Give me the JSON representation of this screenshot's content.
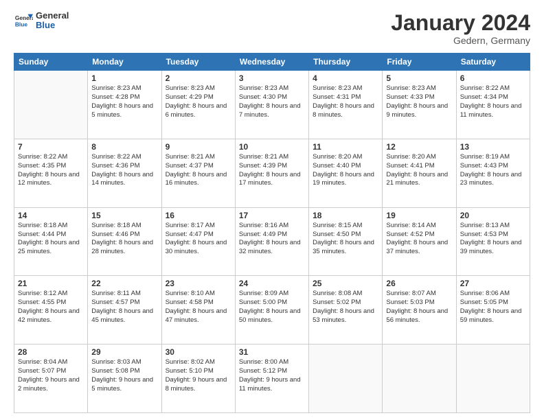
{
  "logo": {
    "text_general": "General",
    "text_blue": "Blue"
  },
  "header": {
    "month_title": "January 2024",
    "location": "Gedern, Germany"
  },
  "weekdays": [
    "Sunday",
    "Monday",
    "Tuesday",
    "Wednesday",
    "Thursday",
    "Friday",
    "Saturday"
  ],
  "weeks": [
    [
      {
        "day": "",
        "sunrise": "",
        "sunset": "",
        "daylight": ""
      },
      {
        "day": "1",
        "sunrise": "Sunrise: 8:23 AM",
        "sunset": "Sunset: 4:28 PM",
        "daylight": "Daylight: 8 hours and 5 minutes."
      },
      {
        "day": "2",
        "sunrise": "Sunrise: 8:23 AM",
        "sunset": "Sunset: 4:29 PM",
        "daylight": "Daylight: 8 hours and 6 minutes."
      },
      {
        "day": "3",
        "sunrise": "Sunrise: 8:23 AM",
        "sunset": "Sunset: 4:30 PM",
        "daylight": "Daylight: 8 hours and 7 minutes."
      },
      {
        "day": "4",
        "sunrise": "Sunrise: 8:23 AM",
        "sunset": "Sunset: 4:31 PM",
        "daylight": "Daylight: 8 hours and 8 minutes."
      },
      {
        "day": "5",
        "sunrise": "Sunrise: 8:23 AM",
        "sunset": "Sunset: 4:33 PM",
        "daylight": "Daylight: 8 hours and 9 minutes."
      },
      {
        "day": "6",
        "sunrise": "Sunrise: 8:22 AM",
        "sunset": "Sunset: 4:34 PM",
        "daylight": "Daylight: 8 hours and 11 minutes."
      }
    ],
    [
      {
        "day": "7",
        "sunrise": "Sunrise: 8:22 AM",
        "sunset": "Sunset: 4:35 PM",
        "daylight": "Daylight: 8 hours and 12 minutes."
      },
      {
        "day": "8",
        "sunrise": "Sunrise: 8:22 AM",
        "sunset": "Sunset: 4:36 PM",
        "daylight": "Daylight: 8 hours and 14 minutes."
      },
      {
        "day": "9",
        "sunrise": "Sunrise: 8:21 AM",
        "sunset": "Sunset: 4:37 PM",
        "daylight": "Daylight: 8 hours and 16 minutes."
      },
      {
        "day": "10",
        "sunrise": "Sunrise: 8:21 AM",
        "sunset": "Sunset: 4:39 PM",
        "daylight": "Daylight: 8 hours and 17 minutes."
      },
      {
        "day": "11",
        "sunrise": "Sunrise: 8:20 AM",
        "sunset": "Sunset: 4:40 PM",
        "daylight": "Daylight: 8 hours and 19 minutes."
      },
      {
        "day": "12",
        "sunrise": "Sunrise: 8:20 AM",
        "sunset": "Sunset: 4:41 PM",
        "daylight": "Daylight: 8 hours and 21 minutes."
      },
      {
        "day": "13",
        "sunrise": "Sunrise: 8:19 AM",
        "sunset": "Sunset: 4:43 PM",
        "daylight": "Daylight: 8 hours and 23 minutes."
      }
    ],
    [
      {
        "day": "14",
        "sunrise": "Sunrise: 8:18 AM",
        "sunset": "Sunset: 4:44 PM",
        "daylight": "Daylight: 8 hours and 25 minutes."
      },
      {
        "day": "15",
        "sunrise": "Sunrise: 8:18 AM",
        "sunset": "Sunset: 4:46 PM",
        "daylight": "Daylight: 8 hours and 28 minutes."
      },
      {
        "day": "16",
        "sunrise": "Sunrise: 8:17 AM",
        "sunset": "Sunset: 4:47 PM",
        "daylight": "Daylight: 8 hours and 30 minutes."
      },
      {
        "day": "17",
        "sunrise": "Sunrise: 8:16 AM",
        "sunset": "Sunset: 4:49 PM",
        "daylight": "Daylight: 8 hours and 32 minutes."
      },
      {
        "day": "18",
        "sunrise": "Sunrise: 8:15 AM",
        "sunset": "Sunset: 4:50 PM",
        "daylight": "Daylight: 8 hours and 35 minutes."
      },
      {
        "day": "19",
        "sunrise": "Sunrise: 8:14 AM",
        "sunset": "Sunset: 4:52 PM",
        "daylight": "Daylight: 8 hours and 37 minutes."
      },
      {
        "day": "20",
        "sunrise": "Sunrise: 8:13 AM",
        "sunset": "Sunset: 4:53 PM",
        "daylight": "Daylight: 8 hours and 39 minutes."
      }
    ],
    [
      {
        "day": "21",
        "sunrise": "Sunrise: 8:12 AM",
        "sunset": "Sunset: 4:55 PM",
        "daylight": "Daylight: 8 hours and 42 minutes."
      },
      {
        "day": "22",
        "sunrise": "Sunrise: 8:11 AM",
        "sunset": "Sunset: 4:57 PM",
        "daylight": "Daylight: 8 hours and 45 minutes."
      },
      {
        "day": "23",
        "sunrise": "Sunrise: 8:10 AM",
        "sunset": "Sunset: 4:58 PM",
        "daylight": "Daylight: 8 hours and 47 minutes."
      },
      {
        "day": "24",
        "sunrise": "Sunrise: 8:09 AM",
        "sunset": "Sunset: 5:00 PM",
        "daylight": "Daylight: 8 hours and 50 minutes."
      },
      {
        "day": "25",
        "sunrise": "Sunrise: 8:08 AM",
        "sunset": "Sunset: 5:02 PM",
        "daylight": "Daylight: 8 hours and 53 minutes."
      },
      {
        "day": "26",
        "sunrise": "Sunrise: 8:07 AM",
        "sunset": "Sunset: 5:03 PM",
        "daylight": "Daylight: 8 hours and 56 minutes."
      },
      {
        "day": "27",
        "sunrise": "Sunrise: 8:06 AM",
        "sunset": "Sunset: 5:05 PM",
        "daylight": "Daylight: 8 hours and 59 minutes."
      }
    ],
    [
      {
        "day": "28",
        "sunrise": "Sunrise: 8:04 AM",
        "sunset": "Sunset: 5:07 PM",
        "daylight": "Daylight: 9 hours and 2 minutes."
      },
      {
        "day": "29",
        "sunrise": "Sunrise: 8:03 AM",
        "sunset": "Sunset: 5:08 PM",
        "daylight": "Daylight: 9 hours and 5 minutes."
      },
      {
        "day": "30",
        "sunrise": "Sunrise: 8:02 AM",
        "sunset": "Sunset: 5:10 PM",
        "daylight": "Daylight: 9 hours and 8 minutes."
      },
      {
        "day": "31",
        "sunrise": "Sunrise: 8:00 AM",
        "sunset": "Sunset: 5:12 PM",
        "daylight": "Daylight: 9 hours and 11 minutes."
      },
      {
        "day": "",
        "sunrise": "",
        "sunset": "",
        "daylight": ""
      },
      {
        "day": "",
        "sunrise": "",
        "sunset": "",
        "daylight": ""
      },
      {
        "day": "",
        "sunrise": "",
        "sunset": "",
        "daylight": ""
      }
    ]
  ]
}
